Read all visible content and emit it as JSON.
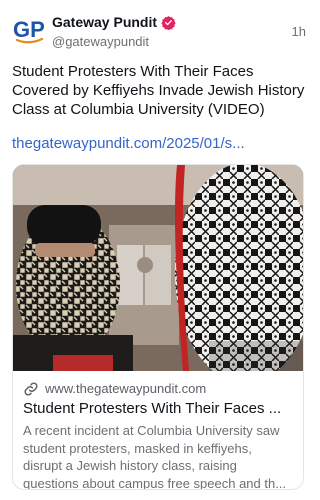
{
  "author": {
    "display_name": "Gateway Pundit",
    "handle": "@gatewaypundit",
    "avatar_text": "GP",
    "verified": true
  },
  "post": {
    "time": "1h",
    "text": "Student Protesters With Their Faces Covered by Keffiyehs Invade Jewish History Class at Columbia University (VIDEO)",
    "link_text": "thegatewaypundit.com/2025/01/s..."
  },
  "link_card": {
    "domain": "www.thegatewaypundit.com",
    "title": "Student Protesters With Their Faces ...",
    "description": "A recent incident at Columbia University saw student protesters, masked in keffiyehs, disrupt a Jewish history class, raising questions about campus free speech and th..."
  },
  "colors": {
    "link": "#3565c9",
    "brand_blue": "#1c56a7",
    "brand_orange": "#e8891c",
    "verified_badge": "#e0245e"
  },
  "icons": {
    "verified": "verified-badge-icon",
    "link": "link-icon"
  }
}
